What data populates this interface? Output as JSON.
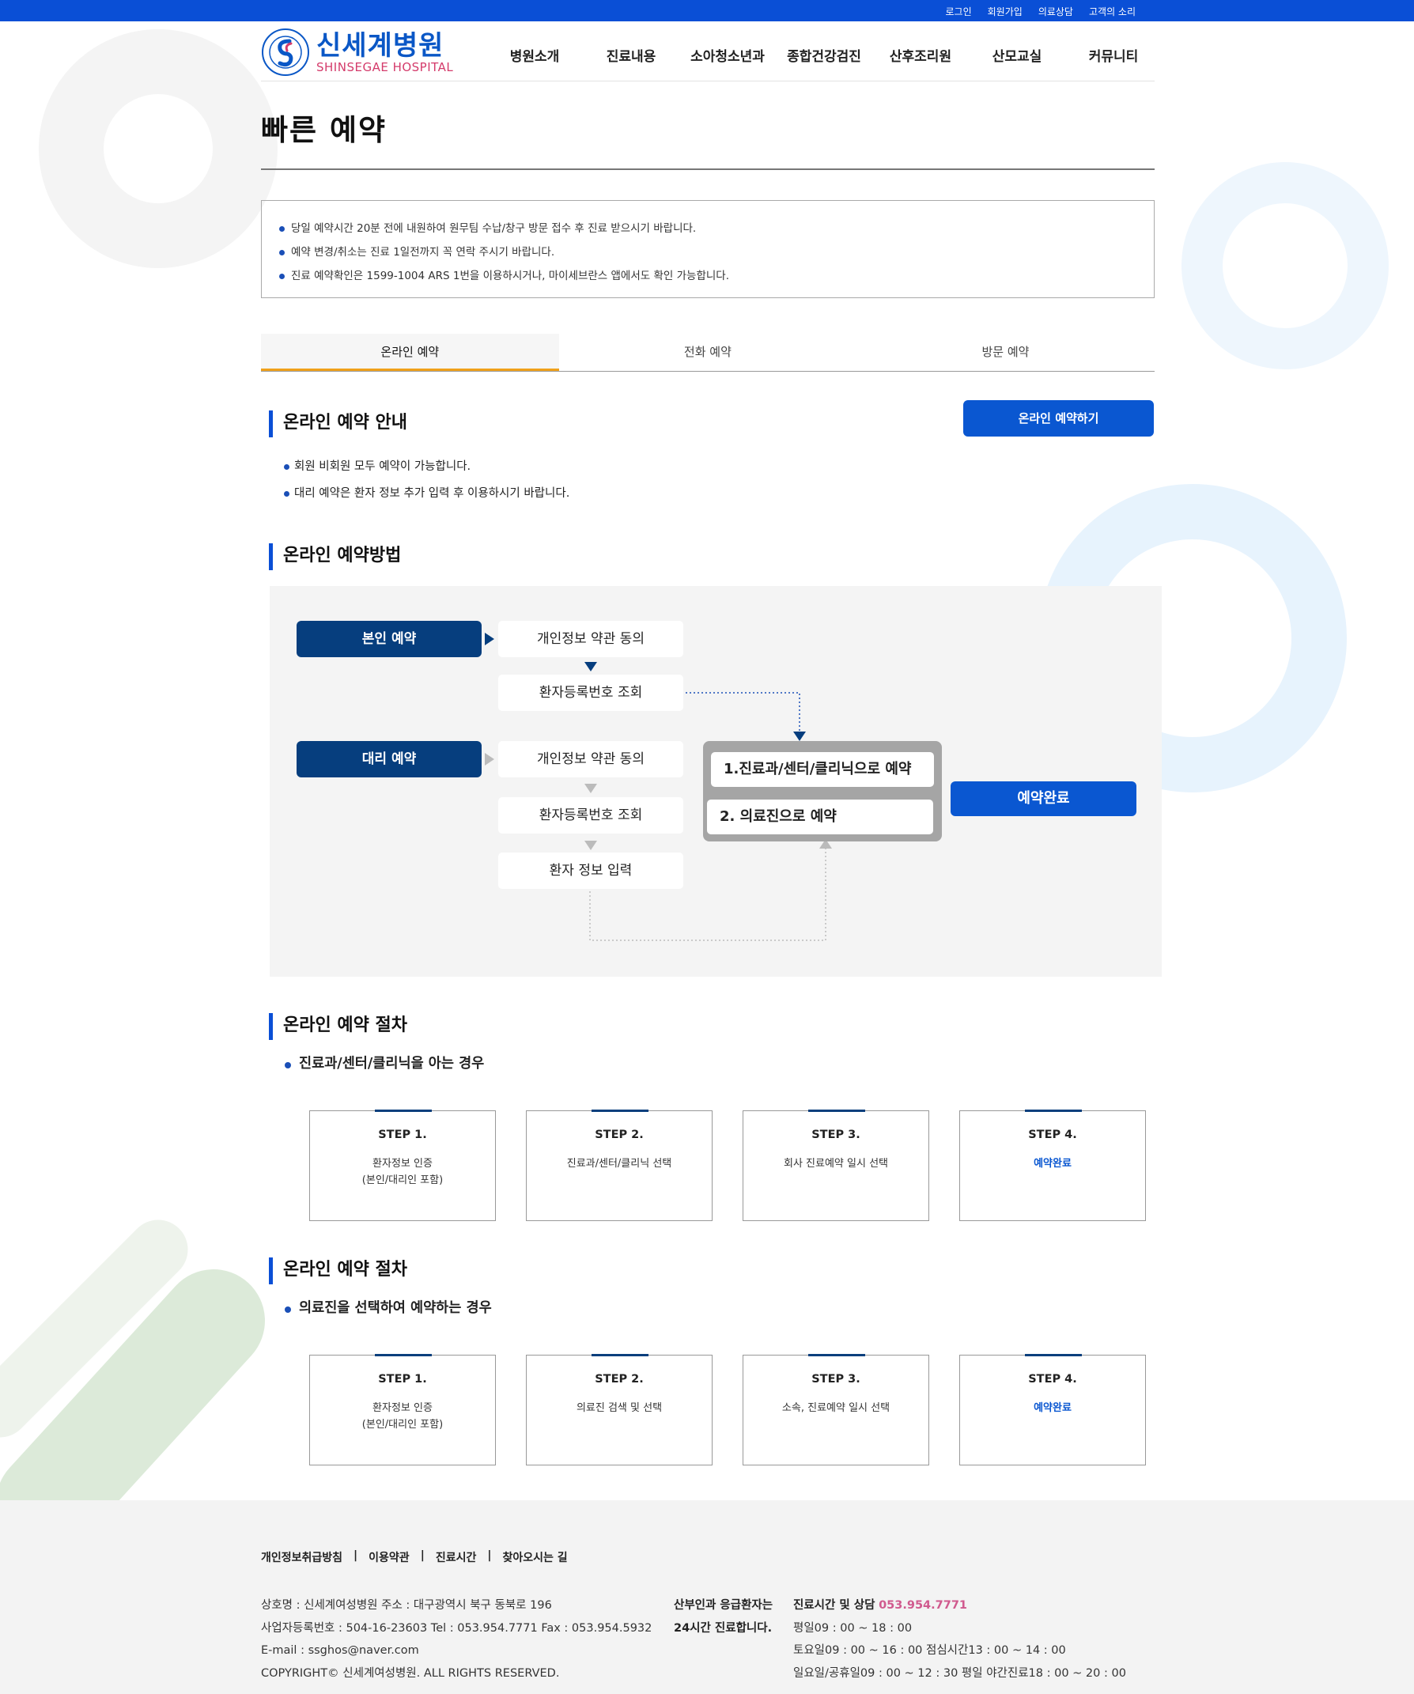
{
  "top_links": [
    "로그인",
    "회원가입",
    "의료상담",
    "고객의 소리"
  ],
  "logo": {
    "ko": "신세계병원",
    "en": "SHINSEGAE HOSPITAL"
  },
  "nav": [
    "병원소개",
    "진료내용",
    "소아청소년과",
    "종합건강검진",
    "산후조리원",
    "산모교실",
    "커뮤니티"
  ],
  "page_title": "빠른 예약",
  "notices": [
    "당일 예약시간 20분 전에 내원하여 원무팀 수납/창구 방문 접수 후 진료 받으시기 바랍니다.",
    "예약 변경/취소는 진료 1일전까지 꼭 연락 주시기 바랍니다.",
    "진료 예약확인은 1599-1004 ARS 1번을 이용하시거나, 마이세브란스 앱에서도 확인 가능합니다."
  ],
  "tabs": [
    "온라인 예약",
    "전화 예약",
    "방문 예약"
  ],
  "guide": {
    "title": "온라인 예약 안내",
    "button": "온라인 예약하기",
    "items": [
      "회원 비회원 모두 예약이 가능합니다.",
      "대리 예약은 환자 정보 추가 입력 후 이용하시기 바랍니다."
    ]
  },
  "method": {
    "title": "온라인 예약방법",
    "self": {
      "label": "본인 예약",
      "steps": [
        "개인정보 약관 동의",
        "환자등록번호 조회"
      ]
    },
    "proxy": {
      "label": "대리 예약",
      "steps": [
        "개인정보 약관 동의",
        "환자등록번호 조회",
        "환자 정보 입력"
      ]
    },
    "options": [
      "1.진료과/센터/클리닉으로 예약",
      "2. 의료진으로 예약"
    ],
    "complete": "예약완료"
  },
  "procedure1": {
    "title": "온라인 예약 절차",
    "subtitle": "진료과/센터/클리닉을 아는 경우",
    "steps": [
      {
        "n": "STEP 1.",
        "d": "환자정보 인증",
        "d2": "(본인/대리인 포함)"
      },
      {
        "n": "STEP 2.",
        "d": "진료과/센터/클리닉 선택",
        "d2": ""
      },
      {
        "n": "STEP 3.",
        "d": "회사 진료예약 일시 선택",
        "d2": ""
      },
      {
        "n": "STEP 4.",
        "d": "예약완료",
        "d2": ""
      }
    ]
  },
  "procedure2": {
    "title": "온라인 예약 절차",
    "subtitle": "의료진을 선택하여 예약하는 경우",
    "steps": [
      {
        "n": "STEP 1.",
        "d": "환자정보 인증",
        "d2": "(본인/대리인 포함)"
      },
      {
        "n": "STEP 2.",
        "d": "의료진 검색 및 선택",
        "d2": ""
      },
      {
        "n": "STEP 3.",
        "d": "소속, 진료예약 일시 선택",
        "d2": ""
      },
      {
        "n": "STEP 4.",
        "d": "예약완료",
        "d2": ""
      }
    ]
  },
  "footer": {
    "links": [
      "개인정보취급방침",
      "이용약관",
      "진료시간",
      "찾아오시는 길"
    ],
    "info": [
      "상호명 : 신세계여성병원 주소 : 대구광역시 북구 동북로 196",
      "사업자등록번호 : 504-16-23603 Tel : 053.954.7771 Fax : 053.954.5932",
      "E-mail : ssghos@naver.com",
      "COPYRIGHT© 신세계여성병원. ALL RIGHTS RESERVED."
    ],
    "emergency": [
      "산부인과 응급환자는",
      "24시간 진료합니다."
    ],
    "hours_title": "진료시간 및 상담",
    "hours_phone": "053.954.7771",
    "hours": [
      "평일09 : 00 ~ 18 : 00",
      "토요일09 : 00 ~ 16 : 00 점심시간13 : 00 ~ 14 : 00",
      "일요일/공휴일09 : 00 ~ 12 : 30 평일 야간진료18 : 00 ~ 20 : 00"
    ]
  },
  "colors": {
    "brand_blue": "#0a4fd6",
    "navy": "#063e7e",
    "tab_accent": "#f0a11a",
    "phone_pink": "#d05a8e"
  }
}
